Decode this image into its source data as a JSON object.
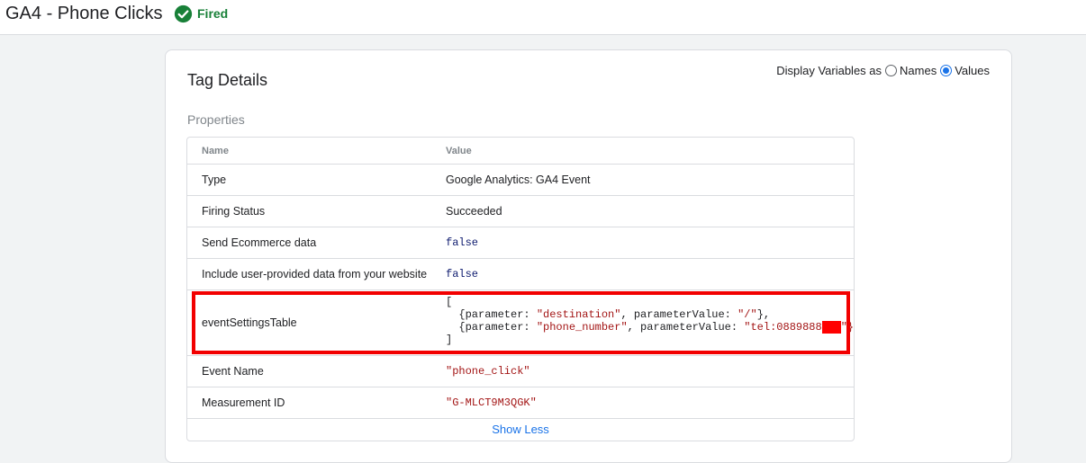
{
  "header": {
    "tag_title": "GA4 - Phone Clicks",
    "status_label": "Fired",
    "status_icon": "check-circle-icon",
    "status_color": "#188038"
  },
  "card": {
    "title": "Tag Details",
    "display_variables": {
      "label": "Display Variables as",
      "option_names": "Names",
      "option_values": "Values",
      "selected": "Values"
    },
    "section_label": "Properties",
    "table": {
      "headers": {
        "name": "Name",
        "value": "Value"
      },
      "rows": [
        {
          "name": "Type",
          "value": "Google Analytics: GA4 Event"
        },
        {
          "name": "Firing Status",
          "value": "Succeeded"
        },
        {
          "name": "Send Ecommerce data",
          "value": "false"
        },
        {
          "name": "Include user-provided data from your website",
          "value": "false"
        },
        {
          "name": "eventSettingsTable",
          "code_lines": [
            "[",
            "  {parameter: \"destination\", parameterValue: \"/\"},",
            "  {parameter: \"phone_number\", parameterValue: \"tel:0889888",
            "]"
          ],
          "code_line3_tail": "\"}"
        },
        {
          "name": "Event Name",
          "value": "\"phone_click\""
        },
        {
          "name": "Measurement ID",
          "value": "\"G-MLCT9M3QGK\""
        }
      ]
    },
    "show_less_label": "Show Less",
    "highlight_color": "#f20000",
    "accent_color": "#1a73e8"
  }
}
